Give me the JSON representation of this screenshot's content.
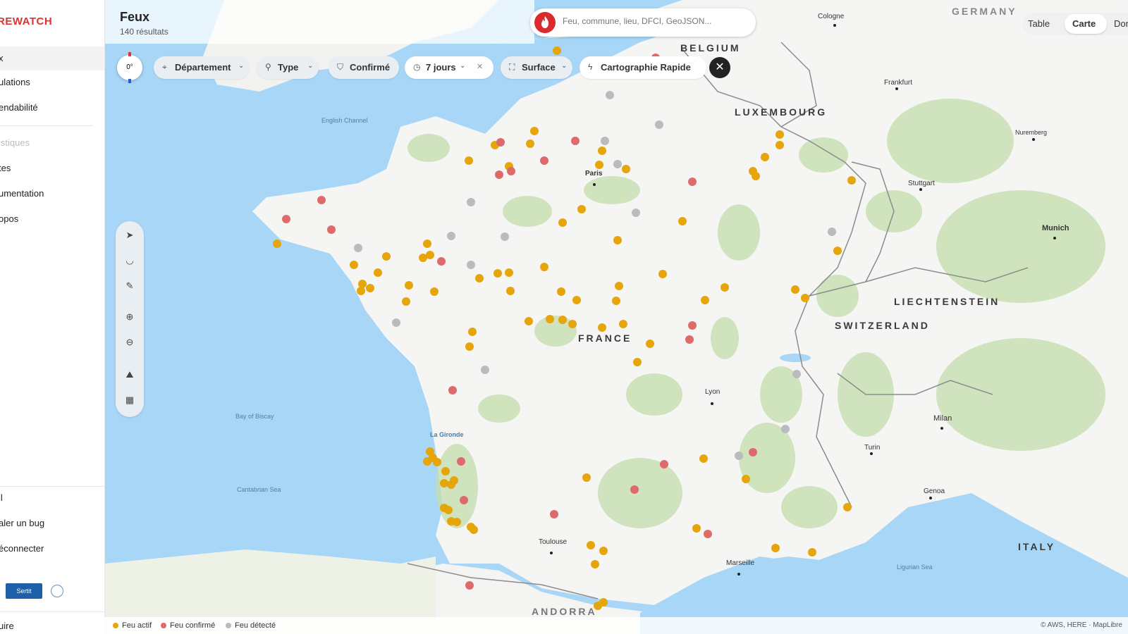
{
  "sidebar": {
    "brand": "REWATCH",
    "items": [
      "x",
      "ulations",
      "endabilité",
      "istiques",
      "tes",
      "umentation",
      "opos"
    ],
    "bottom": [
      "il",
      "aler un bug",
      "éconnecter"
    ],
    "logo_text": "Sertit",
    "footer": "uire"
  },
  "header": {
    "title": "Feux",
    "count": "140 résultats"
  },
  "search": {
    "placeholder": "Feu, commune, lieu, DFCI, GeoJSON..."
  },
  "view_tabs": [
    "Table",
    "Carte",
    "Dor"
  ],
  "compass": "0°",
  "filters": {
    "departement": "Département",
    "type": "Type",
    "confirme": "Confirmé",
    "jours": "7 jours",
    "surface": "Surface",
    "cartographie": "Cartographie Rapide"
  },
  "map": {
    "countries": [
      "BELGIUM",
      "LUXEMBOURG",
      "FRANCE",
      "SWITZERLAND",
      "LIECHTENSTEIN",
      "ITALY",
      "GERMANY",
      "ANDORRA"
    ],
    "cities": [
      "Paris",
      "Lyon",
      "Toulouse",
      "Marseille",
      "Frankfurt",
      "Stuttgart",
      "Munich",
      "Nuremberg",
      "Cologne",
      "Milan",
      "Turin",
      "Genoa"
    ],
    "seas": [
      "English Channel",
      "Bay of Biscay",
      "Cantabrian Sea",
      "Ligurian Sea",
      "La Gironde"
    ]
  },
  "legend": {
    "actif": {
      "label": "Feu actif",
      "color": "#e5a50b"
    },
    "confirme": {
      "label": "Feu confirmé",
      "color": "#de6b6b"
    },
    "detecte": {
      "label": "Feu détecté",
      "color": "#b9bcbf"
    },
    "attribution": "© AWS, HERE · MapLibre"
  },
  "fire_counts": {
    "actif": 90,
    "confirme": 25,
    "detecte": 20
  }
}
